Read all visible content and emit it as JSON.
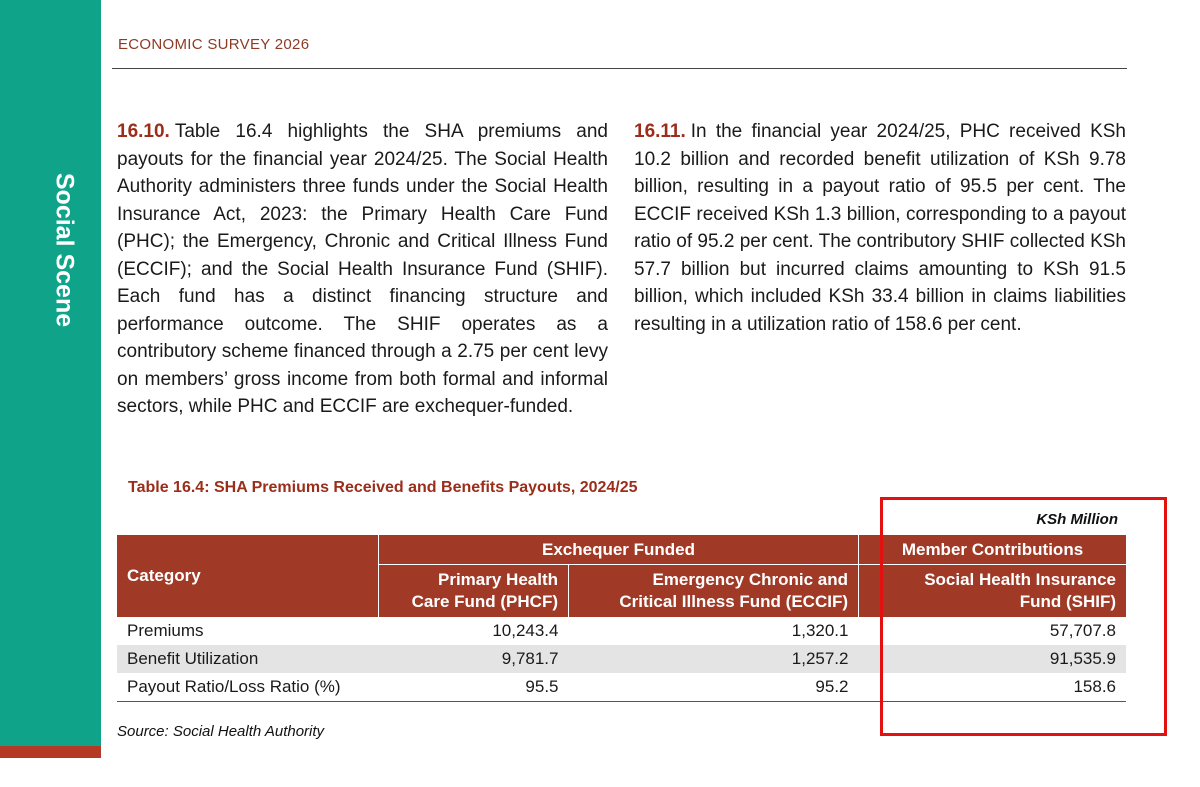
{
  "sidebar": {
    "label": "Social Scene"
  },
  "header": {
    "title": "ECONOMIC SURVEY 2026"
  },
  "paragraphs": [
    {
      "number": "16.10.",
      "text": "Table 16.4 highlights the SHA premiums and payouts for the financial year 2024/25. The Social Health Authority administers three funds under the Social Health Insurance Act, 2023: the Primary Health Care Fund (PHC); the Emergency, Chronic and Critical Illness Fund (ECCIF); and the Social Health Insurance Fund (SHIF). Each fund has a distinct financing structure and performance outcome. The SHIF operates as a contributory scheme financed through a 2.75 per cent levy on members’ gross income from both formal and informal sectors, while PHC and ECCIF are exchequer-funded."
    },
    {
      "number": "16.11.",
      "text": "In the financial year 2024/25, PHC received KSh 10.2 billion and recorded benefit utilization of KSh 9.78 billion, resulting in a payout ratio of 95.5 per cent. The ECCIF received KSh 1.3 billion, corresponding to a payout ratio of 95.2 per cent. The contributory SHIF collected KSh 57.7 billion but incurred claims amounting to KSh 91.5 billion, which included KSh 33.4 billion in claims liabilities resulting in a utilization ratio of 158.6 per cent."
    }
  ],
  "table": {
    "title": "Table 16.4: SHA Premiums Received and Benefits Payouts, 2024/25",
    "unit": "KSh Million",
    "category_header": "Category",
    "group_exchequer": "Exchequer Funded",
    "group_member": "Member Contributions",
    "col_phcf_line1": "Primary Health",
    "col_phcf_line2": "Care Fund (PHCF)",
    "col_eccif_line1": "Emergency Chronic and",
    "col_eccif_line2": "Critical Illness Fund (ECCIF)",
    "col_shif_line1": "Social Health Insurance",
    "col_shif_line2": "Fund (SHIF)",
    "rows": [
      {
        "category": "Premiums",
        "phcf": "10,243.4",
        "eccif": "1,320.1",
        "shif": "57,707.8"
      },
      {
        "category": "Benefit Utilization",
        "phcf": "9,781.7",
        "eccif": "1,257.2",
        "shif": "91,535.9"
      },
      {
        "category": "Payout Ratio/Loss Ratio (%)",
        "phcf": "95.5",
        "eccif": "95.2",
        "shif": "158.6"
      }
    ],
    "source": "Source: Social Health Authority"
  },
  "colors": {
    "sidebar": "#0fa38a",
    "accent": "#a03a26",
    "highlight": "#e31010"
  }
}
